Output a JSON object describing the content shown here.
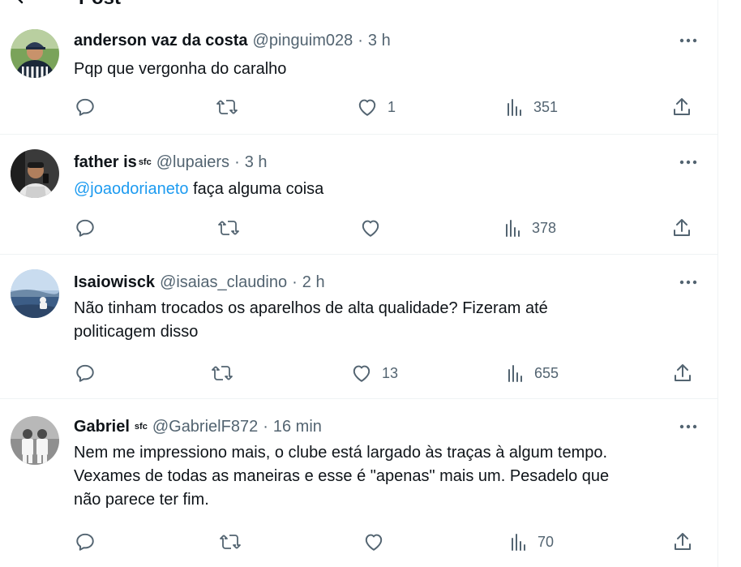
{
  "topbar": {
    "title": "Post"
  },
  "posts": [
    {
      "name": "anderson vaz da costa",
      "badge": "",
      "handle": "@pinguim028",
      "time": "3 h",
      "body_pre": "",
      "mention": "",
      "body": "Pqp que vergonha do caralho",
      "replies": "",
      "reposts": "",
      "likes": "1",
      "views": "351"
    },
    {
      "name": "father is",
      "badge": "sfc",
      "handle": "@lupaiers",
      "time": "3 h",
      "mention": "@joaodorianeto",
      "body": " faça alguma coisa",
      "replies": "",
      "reposts": "",
      "likes": "",
      "views": "378"
    },
    {
      "name": "Isaiowisck",
      "badge": "",
      "handle": "@isaias_claudino",
      "time": "2 h",
      "mention": "",
      "body_line1": "Não tinham trocados os aparelhos de alta qualidade? Fizeram até",
      "body_line2": "politicagem disso",
      "replies": "",
      "reposts": "",
      "likes": "13",
      "views": "655"
    },
    {
      "name": "Gabriel",
      "badge": "sfc",
      "handle": "@GabrielF872",
      "time": "16 min",
      "mention": "",
      "body_line1": "Nem me impressiono mais, o clube está largado às traças à algum tempo.",
      "body_line2": "Vexames de todas as maneiras e esse é \"apenas\" mais um. Pesadelo que",
      "body_line3": "não parece ter fim.",
      "replies": "",
      "reposts": "",
      "likes": "",
      "views": "70"
    }
  ],
  "icons": {
    "back": "back-arrow-icon",
    "more": "more-horizontal-icon",
    "reply": "reply-bubble-icon",
    "repost": "repost-icon",
    "like": "heart-icon",
    "views": "views-bars-icon",
    "share": "share-icon"
  },
  "colors": {
    "text": "#0f1419",
    "secondary": "#536471",
    "link": "#1d9bf0",
    "divider": "#eff3f4"
  }
}
